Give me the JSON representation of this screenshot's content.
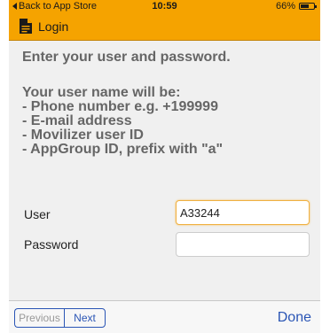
{
  "status_bar": {
    "back_label": "Back to App Store",
    "time": "10:59",
    "battery": "66%",
    "battery_level": 0.66
  },
  "header": {
    "title": "Login",
    "icon": "document-icon"
  },
  "main": {
    "heading": "Enter your user and password.",
    "info_lines": [
      "Your user name will be:",
      "- Phone number e.g. +199999",
      "- E-mail address",
      "- Movilizer user ID",
      "- AppGroup ID, prefix with \"a\""
    ],
    "user": {
      "label": "User",
      "value": "A33244"
    },
    "password": {
      "label": "Password",
      "value": ""
    }
  },
  "accessory": {
    "previous_label": "Previous",
    "next_label": "Next",
    "done_label": "Done"
  },
  "colors": {
    "accent": "#f5a300",
    "link": "#2a55b5",
    "text_muted": "#666666"
  }
}
